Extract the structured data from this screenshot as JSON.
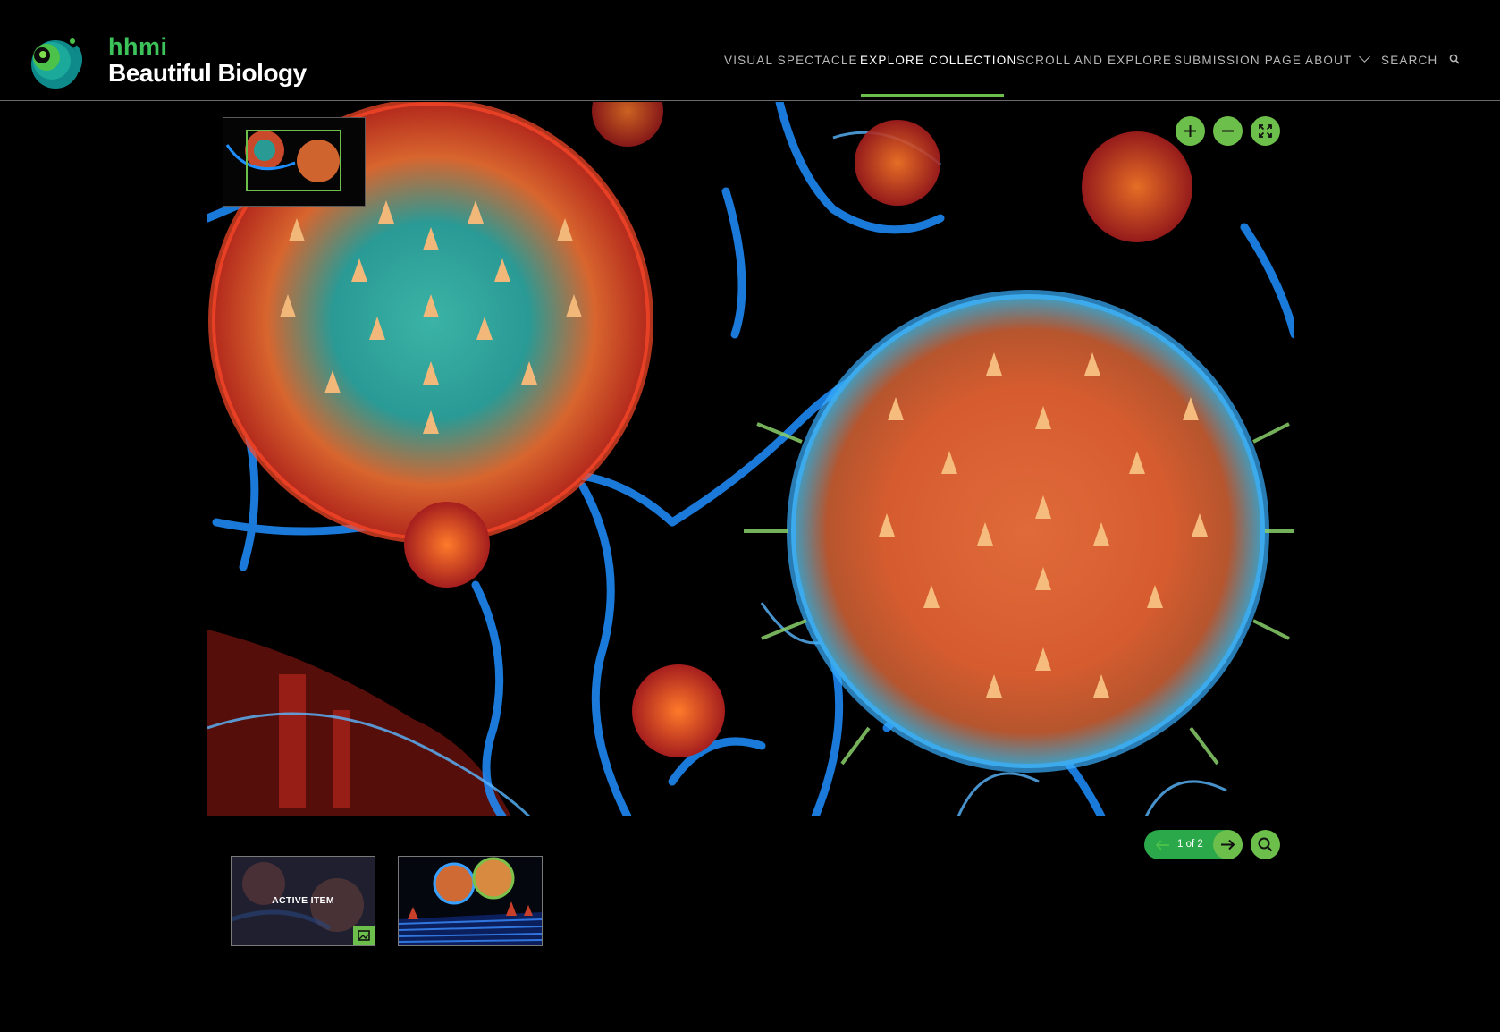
{
  "brand": {
    "top": "hhmi",
    "bottom": "Beautiful Biology"
  },
  "nav": {
    "items": [
      {
        "label": "VISUAL SPECTACLE"
      },
      {
        "label": "EXPLORE COLLECTION"
      },
      {
        "label": "SCROLL AND EXPLORE"
      },
      {
        "label": "SUBMISSION PAGE"
      },
      {
        "label": "ABOUT"
      },
      {
        "label": "SEARCH"
      }
    ],
    "active": "EXPLORE COLLECTION"
  },
  "viewer": {
    "controls": [
      "zoom-in-icon",
      "zoom-out-icon",
      "fullscreen-icon"
    ],
    "pager": {
      "text": "1 of 2"
    }
  },
  "thumbnails": [
    {
      "label": "ACTIVE ITEM",
      "active": true
    },
    {
      "label": "",
      "active": false
    }
  ],
  "colors": {
    "accent": "#6dbf4b",
    "pager": "#2aa84a",
    "brand_green": "#3cc35a"
  }
}
